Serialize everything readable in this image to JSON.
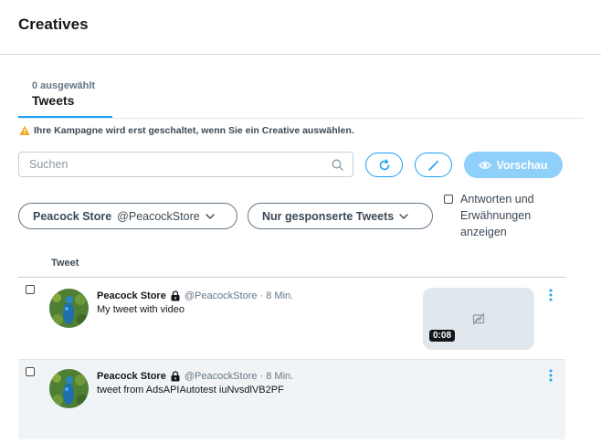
{
  "page": {
    "title": "Creatives"
  },
  "tabs": {
    "selected_count": "0 ausgewählt",
    "active_label": "Tweets"
  },
  "warning": {
    "text": "Ihre Kampagne wird erst geschaltet, wenn Sie ein Creative auswählen."
  },
  "search": {
    "placeholder": "Suchen",
    "value": ""
  },
  "toolbar": {
    "refresh_icon": "refresh-icon",
    "magic_icon": "magic-wand-icon",
    "preview_label": "Vorschau"
  },
  "filters": {
    "store_name": "Peacock Store",
    "store_handle": "@PeacockStore",
    "tweet_type": "Nur gesponserte Tweets",
    "replies_label": "Antworten und Erwähnungen anzeigen",
    "replies_checked": false
  },
  "table": {
    "column_tweet": "Tweet",
    "rows": [
      {
        "name": "Peacock Store",
        "handle": "@PeacockStore · 8 Min.",
        "text": "My tweet with video",
        "duration": "0:08",
        "checked": false
      },
      {
        "name": "Peacock Store",
        "handle": "@PeacockStore · 8 Min.",
        "text": "tweet from AdsAPIAutotest iuNvsdlVB2PF",
        "checked": false
      }
    ]
  },
  "colors": {
    "accent": "#1da1f2",
    "preview_disabled": "#8ed0f9",
    "warning": "#f5a623",
    "row_highlight": "#f1f4f6"
  }
}
